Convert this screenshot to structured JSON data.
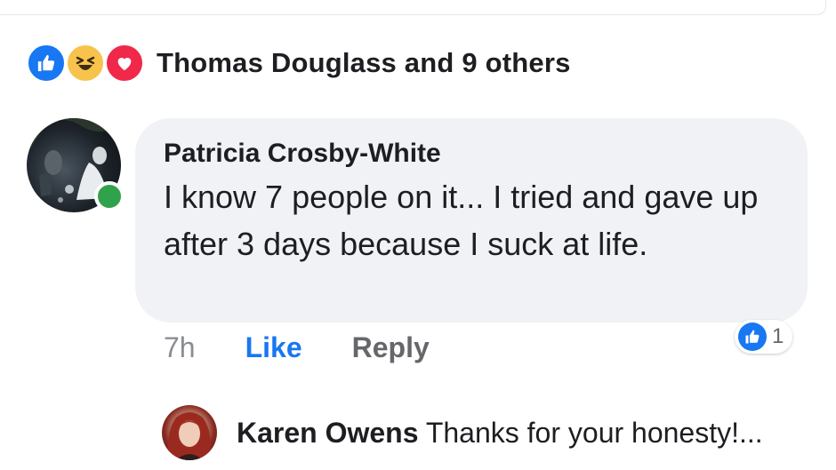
{
  "reactions": {
    "icons": [
      "like-icon",
      "haha-icon",
      "love-icon"
    ],
    "summary": "Thomas Douglass and 9 others"
  },
  "comment": {
    "author": "Patricia Crosby-White",
    "text": "I know 7 people on it... I tried and gave up after 3 days because I suck at life.",
    "time": "7h",
    "like_label": "Like",
    "reply_label": "Reply",
    "like_count": "1",
    "online": true
  },
  "reply": {
    "author": "Karen Owens",
    "text": "Thanks for your honesty!..."
  },
  "colors": {
    "accent": "#1877f2",
    "bubble": "#f0f2f5",
    "online": "#31a24c",
    "love": "#f0284a",
    "haha": "#f7c34c"
  }
}
